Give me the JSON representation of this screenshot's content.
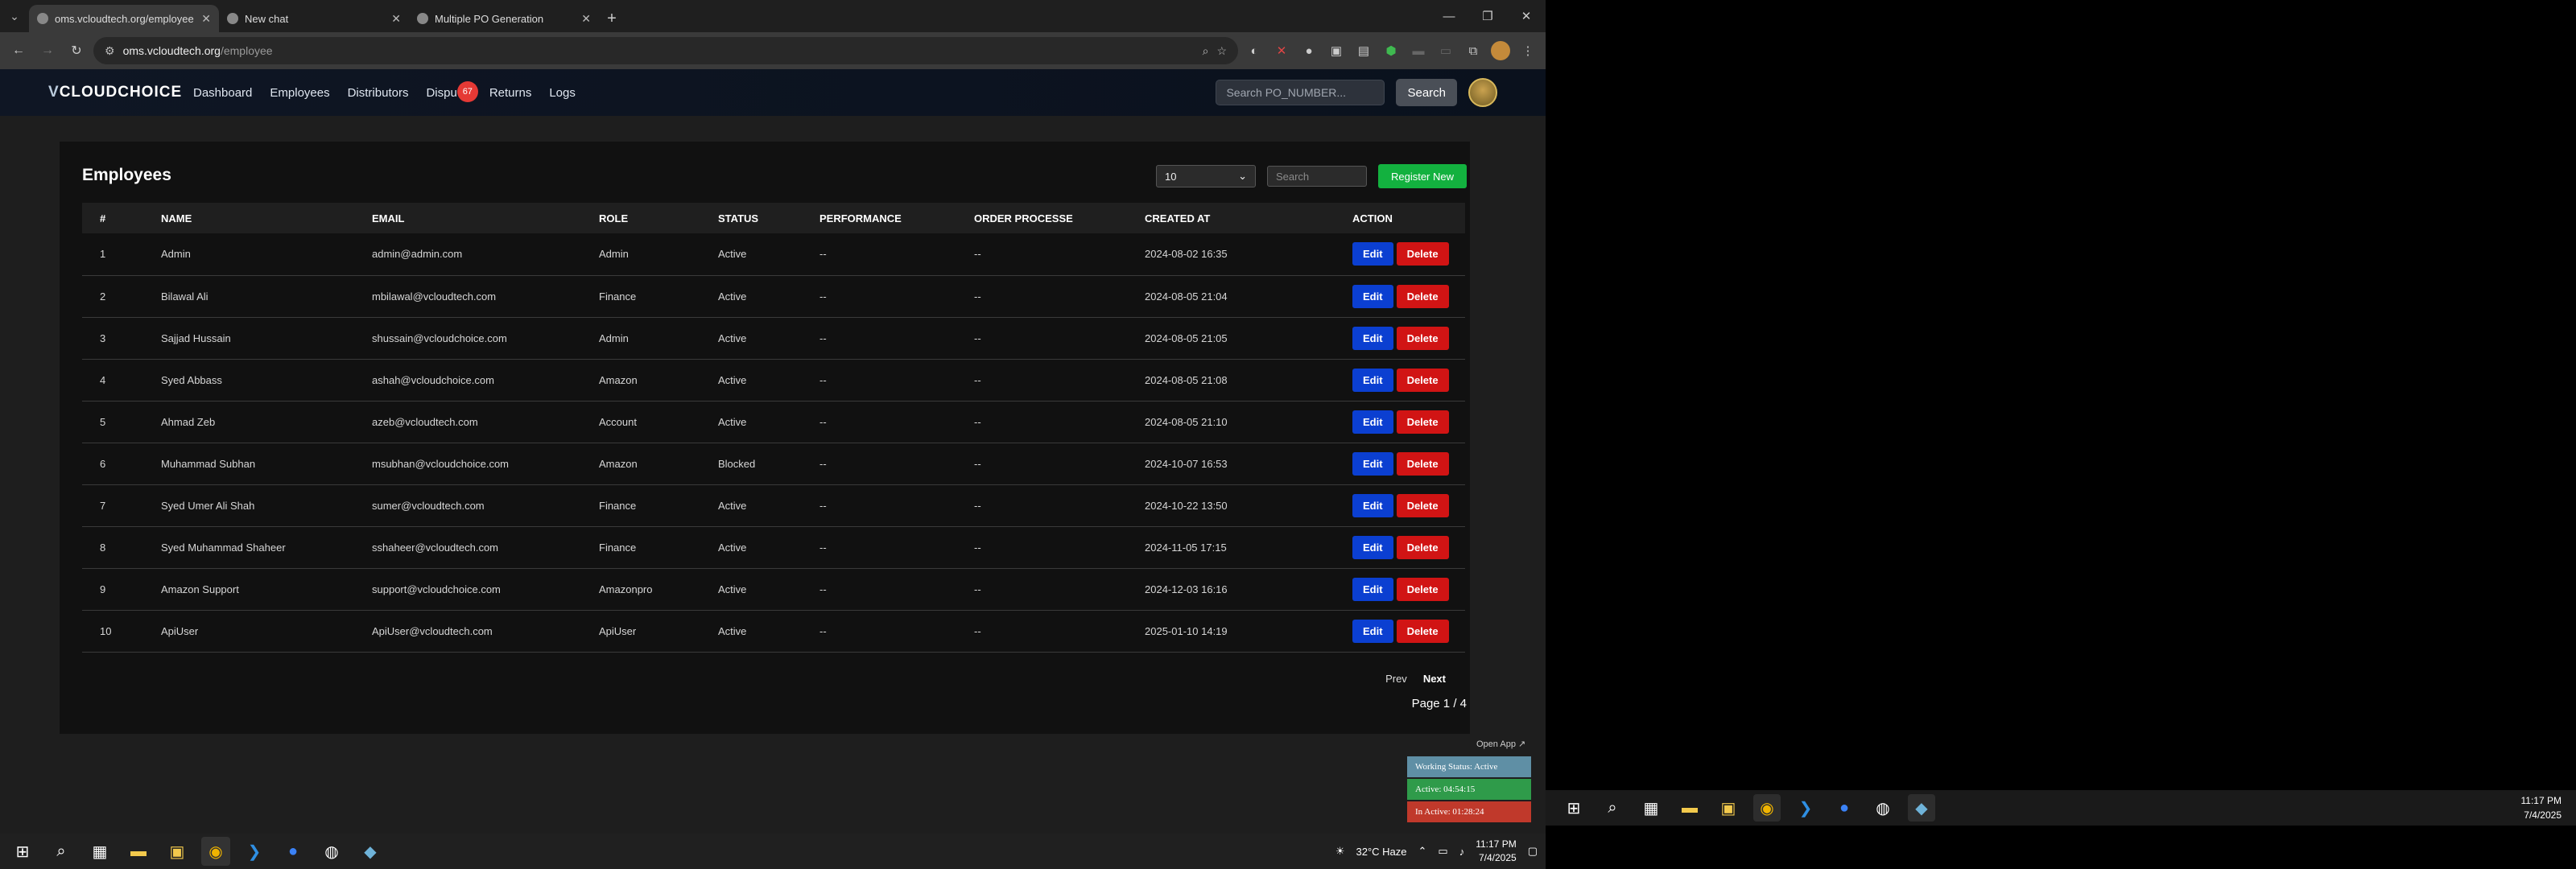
{
  "browser": {
    "tabs": [
      {
        "label": "oms.vcloudtech.org/employee",
        "active": true
      },
      {
        "label": "New chat",
        "active": false
      },
      {
        "label": "Multiple PO Generation",
        "active": false
      }
    ],
    "url_host": "oms.vcloudtech.org",
    "url_path": "/employee"
  },
  "app": {
    "logo_prefix": "V",
    "logo_text": "CLOUDCHOICE",
    "nav": [
      "Dashboard",
      "Employees",
      "Distributors",
      "Dispu",
      "Returns",
      "Logs"
    ],
    "dispute_badge": "67",
    "po_search_placeholder": "Search PO_NUMBER...",
    "search_button": "Search"
  },
  "employees": {
    "title": "Employees",
    "per_page": "10",
    "search_placeholder": "Search",
    "register_button": "Register New",
    "columns": [
      "#",
      "NAME",
      "EMAIL",
      "ROLE",
      "STATUS",
      "PERFORMANCE",
      "ORDER PROCESSE",
      "CREATED AT",
      "ACTION"
    ],
    "rows": [
      {
        "n": "1",
        "name": "Admin",
        "email": "admin@admin.com",
        "role": "Admin",
        "status": "Active",
        "perf": "--",
        "orders": "--",
        "created": "2024-08-02 16:35"
      },
      {
        "n": "2",
        "name": "Bilawal Ali",
        "email": "mbilawal@vcloudtech.com",
        "role": "Finance",
        "status": "Active",
        "perf": "--",
        "orders": "--",
        "created": "2024-08-05 21:04"
      },
      {
        "n": "3",
        "name": "Sajjad Hussain",
        "email": "shussain@vcloudchoice.com",
        "role": "Admin",
        "status": "Active",
        "perf": "--",
        "orders": "--",
        "created": "2024-08-05 21:05"
      },
      {
        "n": "4",
        "name": "Syed Abbass",
        "email": "ashah@vcloudchoice.com",
        "role": "Amazon",
        "status": "Active",
        "perf": "--",
        "orders": "--",
        "created": "2024-08-05 21:08"
      },
      {
        "n": "5",
        "name": "Ahmad Zeb",
        "email": "azeb@vcloudtech.com",
        "role": "Account",
        "status": "Active",
        "perf": "--",
        "orders": "--",
        "created": "2024-08-05 21:10"
      },
      {
        "n": "6",
        "name": "Muhammad Subhan",
        "email": "msubhan@vcloudchoice.com",
        "role": "Amazon",
        "status": "Blocked",
        "perf": "--",
        "orders": "--",
        "created": "2024-10-07 16:53"
      },
      {
        "n": "7",
        "name": "Syed Umer Ali Shah",
        "email": "sumer@vcloudtech.com",
        "role": "Finance",
        "status": "Active",
        "perf": "--",
        "orders": "--",
        "created": "2024-10-22 13:50"
      },
      {
        "n": "8",
        "name": "Syed Muhammad Shaheer",
        "email": "sshaheer@vcloudtech.com",
        "role": "Finance",
        "status": "Active",
        "perf": "--",
        "orders": "--",
        "created": "2024-11-05 17:15"
      },
      {
        "n": "9",
        "name": "Amazon Support",
        "email": "support@vcloudchoice.com",
        "role": "Amazonpro",
        "status": "Active",
        "perf": "--",
        "orders": "--",
        "created": "2024-12-03 16:16"
      },
      {
        "n": "10",
        "name": "ApiUser",
        "email": "ApiUser@vcloudtech.com",
        "role": "ApiUser",
        "status": "Active",
        "perf": "--",
        "orders": "--",
        "created": "2025-01-10 14:19"
      }
    ],
    "edit_label": "Edit",
    "delete_label": "Delete",
    "prev": "Prev",
    "next": "Next",
    "page_info": "Page 1 / 4"
  },
  "widget": {
    "open_app": "Open App ↗",
    "working_status": "Working Status: Active",
    "active_time": "Active: 04:54:15",
    "inactive_time": "In Active: 01:28:24"
  },
  "taskbar": {
    "weather": "32°C  Haze",
    "time": "11:17 PM",
    "date": "7/4/2025"
  },
  "taskbar2": {
    "time": "11:17 PM",
    "date": "7/4/2025"
  }
}
